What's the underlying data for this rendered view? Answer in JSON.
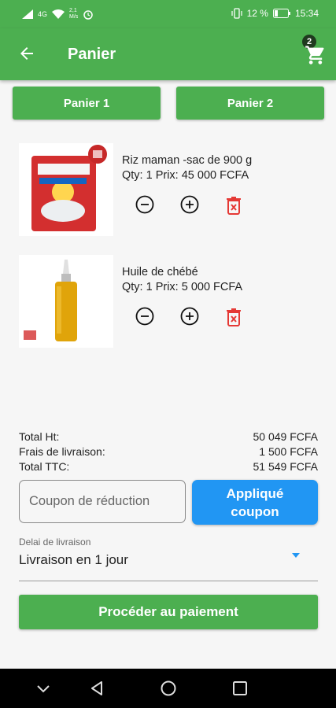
{
  "status": {
    "speed": "2,1",
    "speed_unit": "M/s",
    "signal": "4G",
    "battery": "12 %",
    "time": "15:34"
  },
  "appbar": {
    "title": "Panier",
    "cart_count": "2"
  },
  "tabs": [
    {
      "label": "Panier 1"
    },
    {
      "label": "Panier 2"
    }
  ],
  "items": [
    {
      "name": "Riz maman -sac de 900 g",
      "qty_price": "Qty: 1  Prix: 45 000 FCFA"
    },
    {
      "name": "Huile de chébé",
      "qty_price": "Qty: 1  Prix: 5 000 FCFA"
    }
  ],
  "totals": [
    {
      "label": "Total Ht:",
      "value": "50 049 FCFA"
    },
    {
      "label": "Frais de livraison:",
      "value": "1 500 FCFA"
    },
    {
      "label": "Total TTC:",
      "value": "51 549 FCFA"
    }
  ],
  "coupon": {
    "placeholder": "Coupon de réduction",
    "apply_label_1": "Appliqué",
    "apply_label_2": "coupon"
  },
  "delivery": {
    "label": "Delai de livraison",
    "value": "Livraison en 1 jour"
  },
  "pay_label": "Procéder au paiement",
  "colors": {
    "primary": "#4caf50",
    "accent": "#2196f3",
    "delete": "#e53935"
  },
  "icons": [
    "back-arrow-icon",
    "cart-icon",
    "minus-circle-icon",
    "plus-circle-icon",
    "delete-icon",
    "dropdown-caret-icon",
    "nav-back-icon",
    "nav-home-icon",
    "nav-recents-icon"
  ]
}
